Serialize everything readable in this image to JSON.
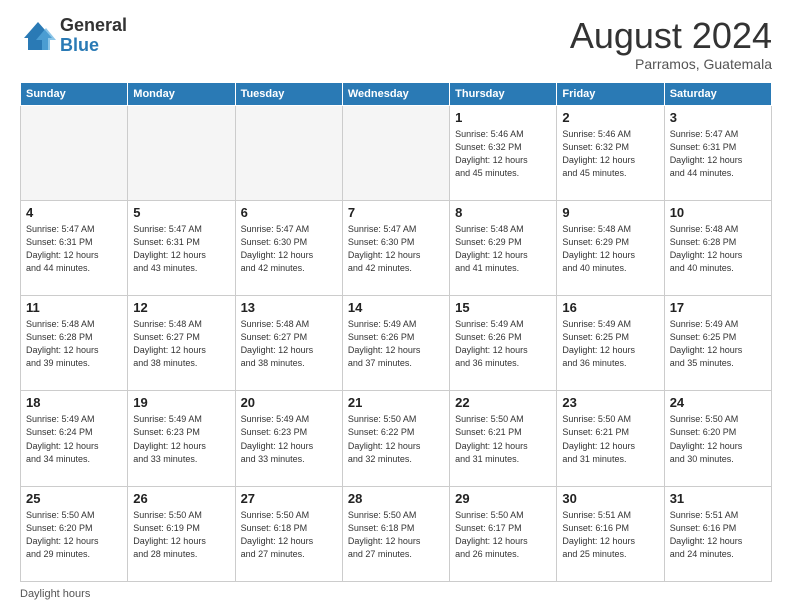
{
  "logo": {
    "general": "General",
    "blue": "Blue"
  },
  "header": {
    "month": "August 2024",
    "location": "Parramos, Guatemala"
  },
  "weekdays": [
    "Sunday",
    "Monday",
    "Tuesday",
    "Wednesday",
    "Thursday",
    "Friday",
    "Saturday"
  ],
  "footer": {
    "label": "Daylight hours"
  },
  "weeks": [
    [
      {
        "day": "",
        "info": ""
      },
      {
        "day": "",
        "info": ""
      },
      {
        "day": "",
        "info": ""
      },
      {
        "day": "",
        "info": ""
      },
      {
        "day": "1",
        "info": "Sunrise: 5:46 AM\nSunset: 6:32 PM\nDaylight: 12 hours\nand 45 minutes."
      },
      {
        "day": "2",
        "info": "Sunrise: 5:46 AM\nSunset: 6:32 PM\nDaylight: 12 hours\nand 45 minutes."
      },
      {
        "day": "3",
        "info": "Sunrise: 5:47 AM\nSunset: 6:31 PM\nDaylight: 12 hours\nand 44 minutes."
      }
    ],
    [
      {
        "day": "4",
        "info": "Sunrise: 5:47 AM\nSunset: 6:31 PM\nDaylight: 12 hours\nand 44 minutes."
      },
      {
        "day": "5",
        "info": "Sunrise: 5:47 AM\nSunset: 6:31 PM\nDaylight: 12 hours\nand 43 minutes."
      },
      {
        "day": "6",
        "info": "Sunrise: 5:47 AM\nSunset: 6:30 PM\nDaylight: 12 hours\nand 42 minutes."
      },
      {
        "day": "7",
        "info": "Sunrise: 5:47 AM\nSunset: 6:30 PM\nDaylight: 12 hours\nand 42 minutes."
      },
      {
        "day": "8",
        "info": "Sunrise: 5:48 AM\nSunset: 6:29 PM\nDaylight: 12 hours\nand 41 minutes."
      },
      {
        "day": "9",
        "info": "Sunrise: 5:48 AM\nSunset: 6:29 PM\nDaylight: 12 hours\nand 40 minutes."
      },
      {
        "day": "10",
        "info": "Sunrise: 5:48 AM\nSunset: 6:28 PM\nDaylight: 12 hours\nand 40 minutes."
      }
    ],
    [
      {
        "day": "11",
        "info": "Sunrise: 5:48 AM\nSunset: 6:28 PM\nDaylight: 12 hours\nand 39 minutes."
      },
      {
        "day": "12",
        "info": "Sunrise: 5:48 AM\nSunset: 6:27 PM\nDaylight: 12 hours\nand 38 minutes."
      },
      {
        "day": "13",
        "info": "Sunrise: 5:48 AM\nSunset: 6:27 PM\nDaylight: 12 hours\nand 38 minutes."
      },
      {
        "day": "14",
        "info": "Sunrise: 5:49 AM\nSunset: 6:26 PM\nDaylight: 12 hours\nand 37 minutes."
      },
      {
        "day": "15",
        "info": "Sunrise: 5:49 AM\nSunset: 6:26 PM\nDaylight: 12 hours\nand 36 minutes."
      },
      {
        "day": "16",
        "info": "Sunrise: 5:49 AM\nSunset: 6:25 PM\nDaylight: 12 hours\nand 36 minutes."
      },
      {
        "day": "17",
        "info": "Sunrise: 5:49 AM\nSunset: 6:25 PM\nDaylight: 12 hours\nand 35 minutes."
      }
    ],
    [
      {
        "day": "18",
        "info": "Sunrise: 5:49 AM\nSunset: 6:24 PM\nDaylight: 12 hours\nand 34 minutes."
      },
      {
        "day": "19",
        "info": "Sunrise: 5:49 AM\nSunset: 6:23 PM\nDaylight: 12 hours\nand 33 minutes."
      },
      {
        "day": "20",
        "info": "Sunrise: 5:49 AM\nSunset: 6:23 PM\nDaylight: 12 hours\nand 33 minutes."
      },
      {
        "day": "21",
        "info": "Sunrise: 5:50 AM\nSunset: 6:22 PM\nDaylight: 12 hours\nand 32 minutes."
      },
      {
        "day": "22",
        "info": "Sunrise: 5:50 AM\nSunset: 6:21 PM\nDaylight: 12 hours\nand 31 minutes."
      },
      {
        "day": "23",
        "info": "Sunrise: 5:50 AM\nSunset: 6:21 PM\nDaylight: 12 hours\nand 31 minutes."
      },
      {
        "day": "24",
        "info": "Sunrise: 5:50 AM\nSunset: 6:20 PM\nDaylight: 12 hours\nand 30 minutes."
      }
    ],
    [
      {
        "day": "25",
        "info": "Sunrise: 5:50 AM\nSunset: 6:20 PM\nDaylight: 12 hours\nand 29 minutes."
      },
      {
        "day": "26",
        "info": "Sunrise: 5:50 AM\nSunset: 6:19 PM\nDaylight: 12 hours\nand 28 minutes."
      },
      {
        "day": "27",
        "info": "Sunrise: 5:50 AM\nSunset: 6:18 PM\nDaylight: 12 hours\nand 27 minutes."
      },
      {
        "day": "28",
        "info": "Sunrise: 5:50 AM\nSunset: 6:18 PM\nDaylight: 12 hours\nand 27 minutes."
      },
      {
        "day": "29",
        "info": "Sunrise: 5:50 AM\nSunset: 6:17 PM\nDaylight: 12 hours\nand 26 minutes."
      },
      {
        "day": "30",
        "info": "Sunrise: 5:51 AM\nSunset: 6:16 PM\nDaylight: 12 hours\nand 25 minutes."
      },
      {
        "day": "31",
        "info": "Sunrise: 5:51 AM\nSunset: 6:16 PM\nDaylight: 12 hours\nand 24 minutes."
      }
    ]
  ]
}
